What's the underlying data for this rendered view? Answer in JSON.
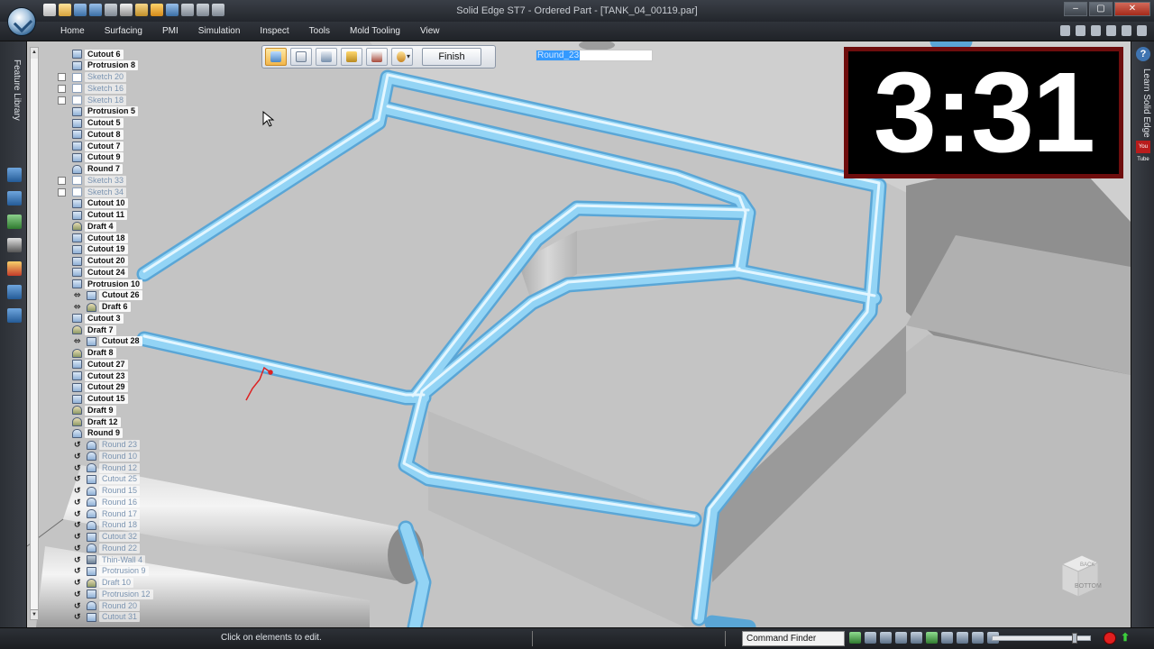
{
  "window": {
    "title": "Solid Edge ST7 - Ordered Part - [TANK_04_00119.par]",
    "controls": {
      "minimize": "–",
      "maximize": "▢",
      "close": "✕"
    }
  },
  "ribbon": {
    "tabs": [
      "Home",
      "Surfacing",
      "PMI",
      "Simulation",
      "Inspect",
      "Tools",
      "Mold Tooling",
      "View"
    ]
  },
  "left_toolbar": {
    "label": "Feature Library"
  },
  "command_bar": {
    "buttons": [
      "select-face-icon",
      "list-icon",
      "properties-icon",
      "solid-box-icon",
      "solid-box-outline-icon",
      "options-icon"
    ],
    "finish_label": "Finish"
  },
  "name_edit": {
    "value": "Round_23"
  },
  "timer": {
    "value": "3:31"
  },
  "right_panel": {
    "label": "Learn Solid Edge",
    "help": "?",
    "video": "You Tube"
  },
  "view_cube": {
    "faces": [
      "BACK",
      "BOTTOM"
    ]
  },
  "status_bar": {
    "message": "Click on elements to edit.",
    "command_finder": "Command Finder"
  },
  "colors": {
    "tube": "#8fd0f3",
    "tube_highlight": "#d4f0ff",
    "part_surface": "#c6c6c6",
    "timer_border": "#6e0d0d"
  },
  "feature_tree": [
    {
      "label": "Cutout 6",
      "icon": "cutout",
      "faded": false,
      "marker": ""
    },
    {
      "label": "Protrusion 8",
      "icon": "protrusion",
      "faded": false,
      "marker": ""
    },
    {
      "label": "Sketch 20",
      "icon": "sketch",
      "faded": true,
      "marker": "checkbox"
    },
    {
      "label": "Sketch 16",
      "icon": "sketch",
      "faded": true,
      "marker": "checkbox"
    },
    {
      "label": "Sketch 18",
      "icon": "sketch",
      "faded": true,
      "marker": "checkbox"
    },
    {
      "label": "Protrusion 5",
      "icon": "protrusion",
      "faded": false,
      "marker": ""
    },
    {
      "label": "Cutout 5",
      "icon": "cutout",
      "faded": false,
      "marker": ""
    },
    {
      "label": "Cutout 8",
      "icon": "cutout",
      "faded": false,
      "marker": ""
    },
    {
      "label": "Cutout 7",
      "icon": "cutout",
      "faded": false,
      "marker": ""
    },
    {
      "label": "Cutout 9",
      "icon": "cutout",
      "faded": false,
      "marker": ""
    },
    {
      "label": "Round 7",
      "icon": "round",
      "faded": false,
      "marker": ""
    },
    {
      "label": "Sketch 33",
      "icon": "sketch",
      "faded": true,
      "marker": "checkbox"
    },
    {
      "label": "Sketch 34",
      "icon": "sketch",
      "faded": true,
      "marker": "checkbox"
    },
    {
      "label": "Cutout 10",
      "icon": "cutout",
      "faded": false,
      "marker": ""
    },
    {
      "label": "Cutout 11",
      "icon": "cutout",
      "faded": false,
      "marker": ""
    },
    {
      "label": "Draft 4",
      "icon": "draft",
      "faded": false,
      "marker": ""
    },
    {
      "label": "Cutout 18",
      "icon": "cutout",
      "faded": false,
      "marker": ""
    },
    {
      "label": "Cutout 19",
      "icon": "cutout",
      "faded": false,
      "marker": ""
    },
    {
      "label": "Cutout 20",
      "icon": "cutout",
      "faded": false,
      "marker": ""
    },
    {
      "label": "Cutout 24",
      "icon": "cutout",
      "faded": false,
      "marker": ""
    },
    {
      "label": "Protrusion 10",
      "icon": "protrusion",
      "faded": false,
      "marker": ""
    },
    {
      "label": "Cutout 26",
      "icon": "cutout",
      "faded": false,
      "marker": "link"
    },
    {
      "label": "Draft 6",
      "icon": "draft",
      "faded": false,
      "marker": "link"
    },
    {
      "label": "Cutout 3",
      "icon": "cutout",
      "faded": false,
      "marker": ""
    },
    {
      "label": "Draft 7",
      "icon": "draft",
      "faded": false,
      "marker": ""
    },
    {
      "label": "Cutout 28",
      "icon": "cutout",
      "faded": false,
      "marker": "link"
    },
    {
      "label": "Draft 8",
      "icon": "draft",
      "faded": false,
      "marker": ""
    },
    {
      "label": "Cutout 27",
      "icon": "cutout",
      "faded": false,
      "marker": ""
    },
    {
      "label": "Cutout 23",
      "icon": "cutout",
      "faded": false,
      "marker": ""
    },
    {
      "label": "Cutout 29",
      "icon": "cutout",
      "faded": false,
      "marker": ""
    },
    {
      "label": "Cutout 15",
      "icon": "cutout",
      "faded": false,
      "marker": ""
    },
    {
      "label": "Draft 9",
      "icon": "draft",
      "faded": false,
      "marker": ""
    },
    {
      "label": "Draft 12",
      "icon": "draft",
      "faded": false,
      "marker": ""
    },
    {
      "label": "Round 9",
      "icon": "round",
      "faded": false,
      "marker": ""
    },
    {
      "label": "Round 23",
      "icon": "round",
      "faded": true,
      "marker": "rollback"
    },
    {
      "label": "Round 10",
      "icon": "round",
      "faded": true,
      "marker": "rollback"
    },
    {
      "label": "Round 12",
      "icon": "round",
      "faded": true,
      "marker": "rollback"
    },
    {
      "label": "Cutout 25",
      "icon": "cutout",
      "faded": true,
      "marker": "rollback"
    },
    {
      "label": "Round 15",
      "icon": "round",
      "faded": true,
      "marker": "rollback"
    },
    {
      "label": "Round 16",
      "icon": "round",
      "faded": true,
      "marker": "rollback"
    },
    {
      "label": "Round 17",
      "icon": "round",
      "faded": true,
      "marker": "rollback"
    },
    {
      "label": "Round 18",
      "icon": "round",
      "faded": true,
      "marker": "rollback"
    },
    {
      "label": "Cutout 32",
      "icon": "cutout",
      "faded": true,
      "marker": "rollback"
    },
    {
      "label": "Round 22",
      "icon": "round",
      "faded": true,
      "marker": "rollback"
    },
    {
      "label": "Thin-Wall 4",
      "icon": "shell",
      "faded": true,
      "marker": "rollback"
    },
    {
      "label": "Protrusion 9",
      "icon": "protrusion",
      "faded": true,
      "marker": "rollback"
    },
    {
      "label": "Draft 10",
      "icon": "draft",
      "faded": true,
      "marker": "rollback"
    },
    {
      "label": "Protrusion 12",
      "icon": "protrusion",
      "faded": true,
      "marker": "rollback"
    },
    {
      "label": "Round 20",
      "icon": "round",
      "faded": true,
      "marker": "rollback"
    },
    {
      "label": "Cutout 31",
      "icon": "cutout",
      "faded": true,
      "marker": "rollback"
    }
  ]
}
